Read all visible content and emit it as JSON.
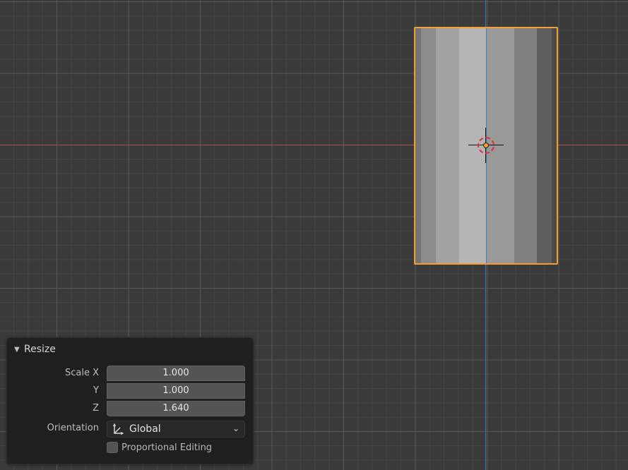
{
  "panel": {
    "title": "Resize",
    "rows": {
      "scale_x": {
        "label": "Scale X",
        "value": "1.000"
      },
      "y": {
        "label": "Y",
        "value": "1.000"
      },
      "z": {
        "label": "Z",
        "value": "1.640"
      },
      "orientation": {
        "label": "Orientation",
        "value": "Global"
      }
    },
    "proportional_editing": {
      "label": "Proportional Editing",
      "checked": false
    }
  },
  "colors": {
    "viewport_bg": "#3a3a3a",
    "x_axis": "#b84a4a",
    "y_axis": "#3f73c8",
    "selection_outline": "#f0a030",
    "panel_bg": "#1f1f1f",
    "field_bg": "#545454"
  },
  "icons": {
    "panel_toggle": "triangle-down-icon",
    "orientation": "transform-orientation-axes-icon",
    "dropdown": "chevron-down-icon",
    "cursor": "3d-cursor-icon"
  }
}
